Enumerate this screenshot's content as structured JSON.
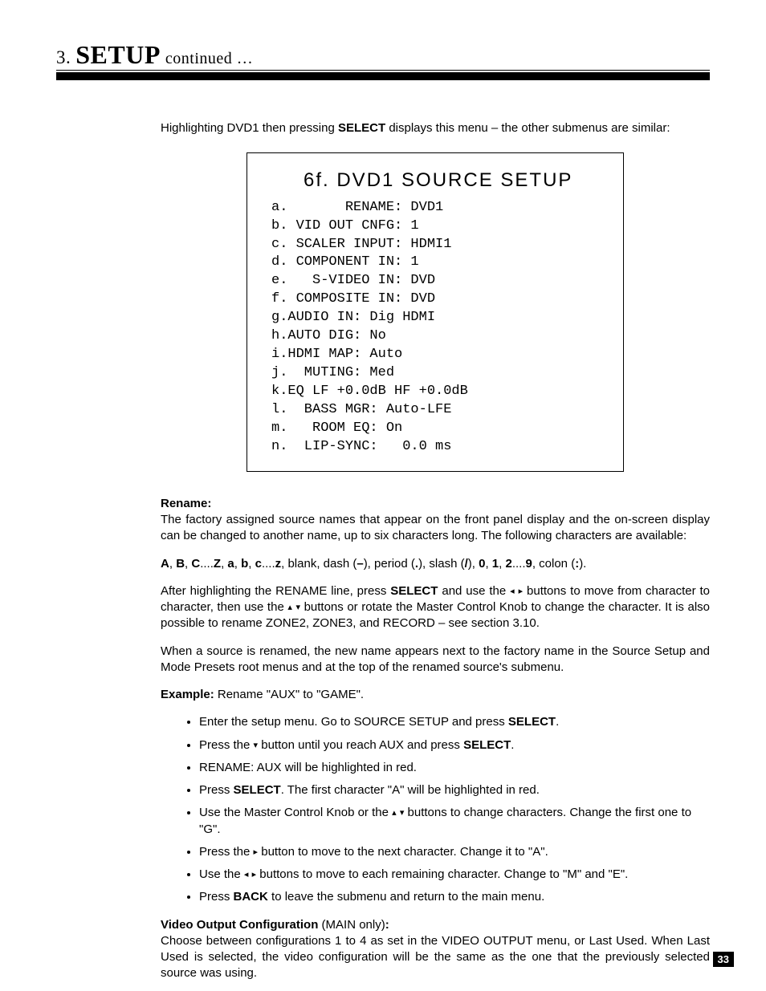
{
  "header": {
    "num": "3.",
    "title": "SETUP",
    "cont": "continued …"
  },
  "intro": {
    "pre": "Highlighting DVD1 then pressing ",
    "select": "SELECT",
    "post": " displays this menu – the other submenus are similar:"
  },
  "menu": {
    "title": "6f. DVD1 SOURCE SETUP",
    "rows": [
      "a.       RENAME: DVD1",
      "b. VID OUT CNFG: 1",
      "c. SCALER INPUT: HDMI1",
      "d. COMPONENT IN: 1",
      "e.   S-VIDEO IN: DVD",
      "f. COMPOSITE IN: DVD",
      "g.AUDIO IN: Dig HDMI",
      "h.AUTO DIG: No",
      "i.HDMI MAP: Auto",
      "j.  MUTING: Med",
      "k.EQ LF +0.0dB HF +0.0dB",
      "l.  BASS MGR: Auto-LFE",
      "m.   ROOM EQ: On",
      "n.  LIP-SYNC:   0.0 ms"
    ]
  },
  "rename": {
    "label": "Rename:",
    "body": "The factory assigned source names that appear on the front panel display and the on-screen display can be changed to another name, up to six characters long. The following characters are available:"
  },
  "chars": {
    "A": "A",
    "B": "B",
    "C": "C",
    "Z": "Z",
    "a": "a",
    "b": "b",
    "c": "c",
    "z": "z",
    "zero": "0",
    "one": "1",
    "two": "2",
    "nine": "9",
    "dash": "–",
    "dot": ".",
    "slash": "/",
    "colon": ":"
  },
  "after1": {
    "pre": "After highlighting the RENAME line, press ",
    "select": "SELECT",
    "mid1": " and use the ",
    "mid2": " buttons to move from character to character, then use the ",
    "mid3": " buttons or rotate the Master Control Knob to change the character. It is also possible to rename ZONE2, ZONE3, and RECORD – see section 3.10."
  },
  "after2": "When a source is renamed, the new name appears next to the factory name in the Source Setup and Mode Presets root menus and at the top of the renamed source's submenu.",
  "example_label": "Example:",
  "example_text": "  Rename \"AUX\" to \"GAME\".",
  "bullets": {
    "b1a": "Enter the setup menu. Go to SOURCE SETUP and press ",
    "b1b": "SELECT",
    "b1c": ".",
    "b2a": "Press the ",
    "b2b": " button until you reach AUX and press ",
    "b2c": "SELECT",
    "b2d": ".",
    "b3": "RENAME: AUX will be highlighted in red.",
    "b4a": "Press ",
    "b4b": "SELECT",
    "b4c": ". The first character \"A\" will be highlighted in red.",
    "b5a": "Use the Master Control Knob or the ",
    "b5b": " buttons to change characters. Change the first one to \"G\".",
    "b6a": "Press the ",
    "b6b": " button to move to the next character. Change it to \"A\".",
    "b7a": "Use the ",
    "b7b": " buttons to move to each remaining character. Change to \"M\" and \"E\".",
    "b8a": "Press ",
    "b8b": "BACK",
    "b8c": " to leave the submenu and return to the main menu."
  },
  "voc": {
    "label": "Video Output Configuration",
    "main": " (MAIN only)",
    "colon": ":",
    "body": "Choose between configurations 1 to 4 as set in the VIDEO OUTPUT menu, or Last Used. When Last Used is selected, the video configuration will be the same as the one that the previously selected source was using."
  },
  "glyph": {
    "left": "◂",
    "right": "▸",
    "up": "▴",
    "down": "▾"
  },
  "pagenum": "33"
}
